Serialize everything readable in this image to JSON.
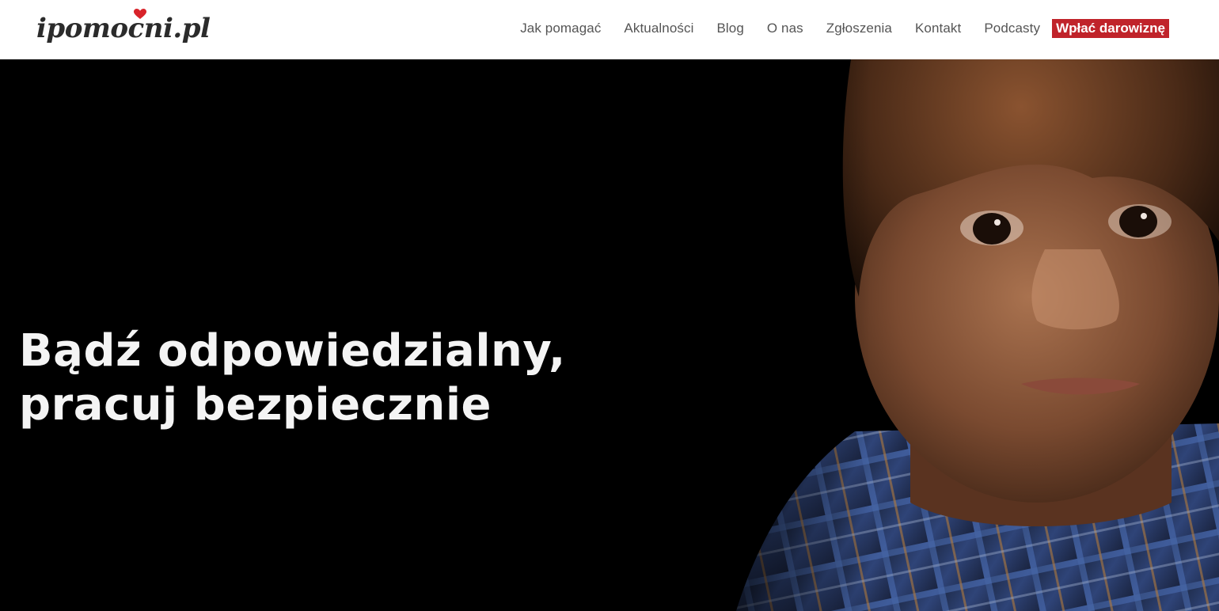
{
  "brand": {
    "logo_text": "ipomocni.pl",
    "heart_color": "#d8232a"
  },
  "nav": {
    "items": [
      {
        "label": "Jak pomagać",
        "name": "nav-item-jak-pomagac"
      },
      {
        "label": "Aktualności",
        "name": "nav-item-aktualnosci"
      },
      {
        "label": "Blog",
        "name": "nav-item-blog"
      },
      {
        "label": "O nas",
        "name": "nav-item-o-nas"
      },
      {
        "label": "Zgłoszenia",
        "name": "nav-item-zgloszenia"
      },
      {
        "label": "Kontakt",
        "name": "nav-item-kontakt"
      },
      {
        "label": "Podcasty",
        "name": "nav-item-podcasty"
      }
    ],
    "donate_label": "Wpłać darowiznę",
    "donate_color": "#c0232a"
  },
  "hero": {
    "heading_line1": "Bądź odpowiedzialny,",
    "heading_line2": "pracuj bezpiecznie",
    "image_icon": "child-portrait-photo"
  }
}
